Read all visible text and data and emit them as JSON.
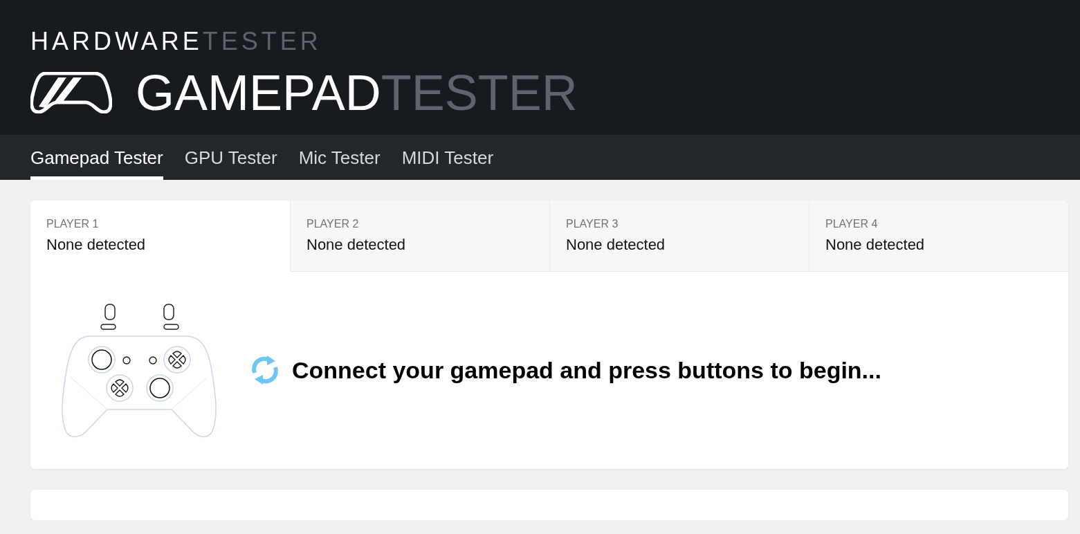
{
  "brand": {
    "overline": {
      "strong": "HARDWARE",
      "muted": "TESTER"
    },
    "title": {
      "strong": "GAMEPAD",
      "muted": "TESTER"
    }
  },
  "nav": [
    {
      "label": "Gamepad Tester",
      "selected": true
    },
    {
      "label": "GPU Tester",
      "selected": false
    },
    {
      "label": "Mic Tester",
      "selected": false
    },
    {
      "label": "MIDI Tester",
      "selected": false
    }
  ],
  "players": [
    {
      "label": "PLAYER 1",
      "status": "None detected",
      "selected": true
    },
    {
      "label": "PLAYER 2",
      "status": "None detected",
      "selected": false
    },
    {
      "label": "PLAYER 3",
      "status": "None detected",
      "selected": false
    },
    {
      "label": "PLAYER 4",
      "status": "None detected",
      "selected": false
    }
  ],
  "message": "Connect your gamepad and press buttons to begin..."
}
